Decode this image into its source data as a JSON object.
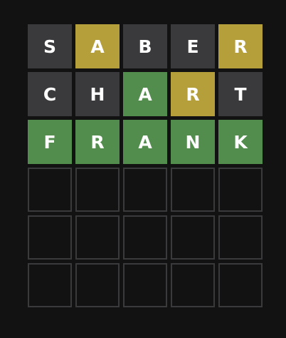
{
  "colors": {
    "background": "#121213",
    "absent": "#3a3a3c",
    "present": "#b59f3b",
    "correct": "#538d4e",
    "empty_border": "#3a3a3c",
    "letter": "#ffffff"
  },
  "board": {
    "rows": [
      [
        {
          "letter": "S",
          "state": "absent"
        },
        {
          "letter": "A",
          "state": "present"
        },
        {
          "letter": "B",
          "state": "absent"
        },
        {
          "letter": "E",
          "state": "absent"
        },
        {
          "letter": "R",
          "state": "present"
        }
      ],
      [
        {
          "letter": "C",
          "state": "absent"
        },
        {
          "letter": "H",
          "state": "absent"
        },
        {
          "letter": "A",
          "state": "correct"
        },
        {
          "letter": "R",
          "state": "present"
        },
        {
          "letter": "T",
          "state": "absent"
        }
      ],
      [
        {
          "letter": "F",
          "state": "correct"
        },
        {
          "letter": "R",
          "state": "correct"
        },
        {
          "letter": "A",
          "state": "correct"
        },
        {
          "letter": "N",
          "state": "correct"
        },
        {
          "letter": "K",
          "state": "correct"
        }
      ],
      [
        {
          "letter": "",
          "state": "empty"
        },
        {
          "letter": "",
          "state": "empty"
        },
        {
          "letter": "",
          "state": "empty"
        },
        {
          "letter": "",
          "state": "empty"
        },
        {
          "letter": "",
          "state": "empty"
        }
      ],
      [
        {
          "letter": "",
          "state": "empty"
        },
        {
          "letter": "",
          "state": "empty"
        },
        {
          "letter": "",
          "state": "empty"
        },
        {
          "letter": "",
          "state": "empty"
        },
        {
          "letter": "",
          "state": "empty"
        }
      ],
      [
        {
          "letter": "",
          "state": "empty"
        },
        {
          "letter": "",
          "state": "empty"
        },
        {
          "letter": "",
          "state": "empty"
        },
        {
          "letter": "",
          "state": "empty"
        },
        {
          "letter": "",
          "state": "empty"
        }
      ]
    ]
  }
}
